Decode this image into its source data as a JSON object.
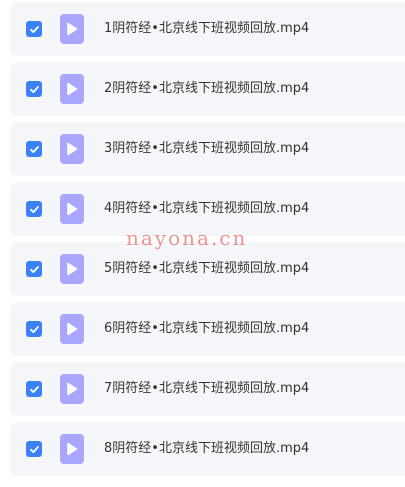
{
  "files": [
    {
      "name": "1阴符经•北京线下班视频回放.mp4",
      "checked": true
    },
    {
      "name": "2阴符经•北京线下班视频回放.mp4",
      "checked": true
    },
    {
      "name": "3阴符经•北京线下班视频回放.mp4",
      "checked": true
    },
    {
      "name": "4阴符经•北京线下班视频回放.mp4",
      "checked": true
    },
    {
      "name": "5阴符经•北京线下班视频回放.mp4",
      "checked": true
    },
    {
      "name": "6阴符经•北京线下班视频回放.mp4",
      "checked": true
    },
    {
      "name": "7阴符经•北京线下班视频回放.mp4",
      "checked": true
    },
    {
      "name": "8阴符经•北京线下班视频回放.mp4",
      "checked": true
    }
  ],
  "watermark": "nayona.cn",
  "icons": {
    "checkbox": "check-icon",
    "file": "video-file-icon"
  },
  "colors": {
    "checkbox": "#3b82f6",
    "file_icon": "#a9a7fb",
    "row_bg": "#f5f6f9",
    "watermark": "#e5736f"
  }
}
